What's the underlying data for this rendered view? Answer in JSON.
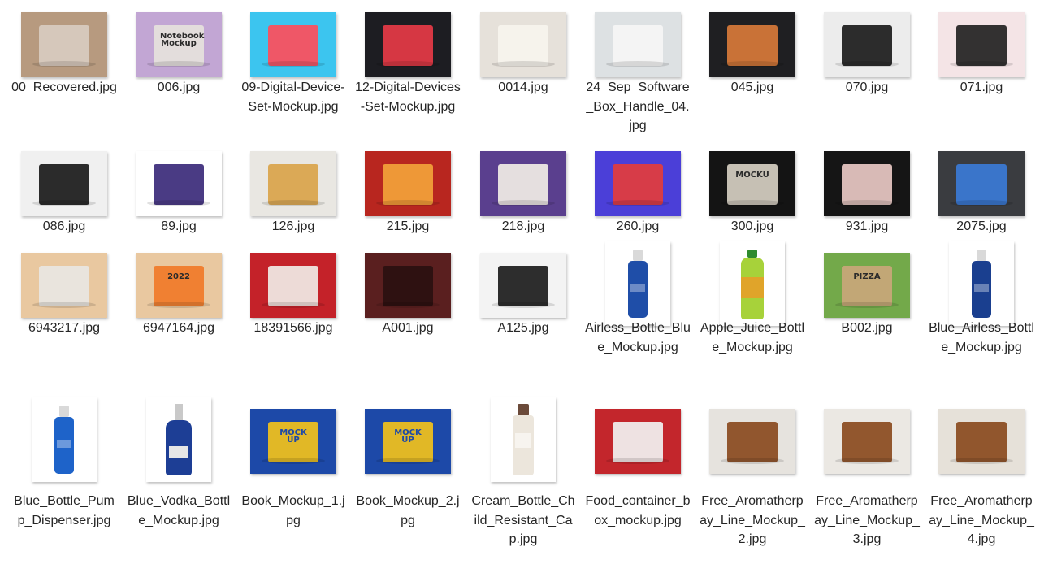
{
  "files": [
    {
      "name": "00_Recovered.jpg",
      "icon": "image-thumbnail",
      "bg": "#b79a7f",
      "accent": "#d8ccc0"
    },
    {
      "name": "006.jpg",
      "icon": "image-thumbnail",
      "bg": "#c2a6d4",
      "accent": "#e6e2dc",
      "text": "Notebook Mockup"
    },
    {
      "name": "09-Digital-Device-Set-Mockup.jpg",
      "icon": "image-thumbnail",
      "bg": "#3cc5ef",
      "accent": "#ff4d5b"
    },
    {
      "name": "12-Digital-Devices-Set-Mockup.jpg",
      "icon": "image-thumbnail",
      "bg": "#1d1d22",
      "accent": "#e63946"
    },
    {
      "name": "0014.jpg",
      "icon": "image-thumbnail",
      "bg": "#e6e1da",
      "accent": "#f7f4ee"
    },
    {
      "name": "24_Sep_Software_Box_Handle_04.jpg",
      "icon": "image-thumbnail",
      "bg": "#dde1e3",
      "accent": "#f5f5f5"
    },
    {
      "name": "045.jpg",
      "icon": "image-thumbnail",
      "bg": "#1f1f22",
      "accent": "#d87a3a"
    },
    {
      "name": "070.jpg",
      "icon": "image-thumbnail",
      "bg": "#ececec",
      "accent": "#1b1b1b"
    },
    {
      "name": "071.jpg",
      "icon": "image-thumbnail",
      "bg": "#f4e4e6",
      "accent": "#222222"
    },
    {
      "name": "086.jpg",
      "icon": "image-thumbnail",
      "bg": "#f0f0f0",
      "accent": "#1a1a1a"
    },
    {
      "name": "89.jpg",
      "icon": "image-thumbnail",
      "bg": "#ffffff",
      "accent": "#3b2a7a"
    },
    {
      "name": "126.jpg",
      "icon": "image-thumbnail",
      "bg": "#e9e7e2",
      "accent": "#d9a44a"
    },
    {
      "name": "215.jpg",
      "icon": "image-thumbnail",
      "bg": "#b8261f",
      "accent": "#f2a23a"
    },
    {
      "name": "218.jpg",
      "icon": "image-thumbnail",
      "bg": "#5a3f8e",
      "accent": "#f1ede6"
    },
    {
      "name": "260.jpg",
      "icon": "image-thumbnail",
      "bg": "#4b3fd8",
      "accent": "#e33c3c"
    },
    {
      "name": "300.jpg",
      "icon": "image-thumbnail",
      "bg": "#141414",
      "accent": "#d6cfc2",
      "text": "MOCKU"
    },
    {
      "name": "931.jpg",
      "icon": "image-thumbnail",
      "bg": "#151515",
      "accent": "#e9c9c4"
    },
    {
      "name": "2075.jpg",
      "icon": "image-thumbnail",
      "bg": "#3a3c40",
      "accent": "#3b7bd6"
    },
    {
      "name": "6943217.jpg",
      "icon": "image-thumbnail",
      "bg": "#e9c8a0",
      "accent": "#e8e6e2"
    },
    {
      "name": "6947164.jpg",
      "icon": "image-thumbnail",
      "bg": "#e9c8a0",
      "accent": "#f07a28",
      "text": "2022"
    },
    {
      "name": "18391566.jpg",
      "icon": "image-thumbnail",
      "bg": "#c42229",
      "accent": "#f0ece6"
    },
    {
      "name": "A001.jpg",
      "icon": "image-thumbnail",
      "bg": "#5a1f1f",
      "accent": "#2a1010"
    },
    {
      "name": "A125.jpg",
      "icon": "image-thumbnail",
      "bg": "#f3f3f3",
      "accent": "#1c1c1c"
    },
    {
      "name": "Airless_Bottle_Blue_Mockup.jpg",
      "icon": "image-thumbnail",
      "bg": "#ffffff",
      "accent": "#1f4ea8",
      "portrait": true,
      "shape": "bottle"
    },
    {
      "name": "Apple_Juice_Bottle_Mockup.jpg",
      "icon": "image-thumbnail",
      "bg": "#ffffff",
      "accent": "#a7d23a",
      "portrait": true,
      "shape": "juice"
    },
    {
      "name": "B002.jpg",
      "icon": "image-thumbnail",
      "bg": "#73a94a",
      "accent": "#c9a77a",
      "text": "PIZZA"
    },
    {
      "name": "Blue_Airless_Bottle_Mockup.jpg",
      "icon": "image-thumbnail",
      "bg": "#ffffff",
      "accent": "#1a3f8f",
      "portrait": true,
      "shape": "bottle"
    },
    {
      "name": "Blue_Bottle_Pump_Dispenser.jpg",
      "icon": "image-thumbnail",
      "bg": "#ffffff",
      "accent": "#1e63c9",
      "portrait": true,
      "shape": "pump"
    },
    {
      "name": "Blue_Vodka_Bottle_Mockup.jpg",
      "icon": "image-thumbnail",
      "bg": "#ffffff",
      "accent": "#1d3e95",
      "portrait": true,
      "shape": "vodka"
    },
    {
      "name": "Book_Mockup_1.jpg",
      "icon": "image-thumbnail",
      "bg": "#1d49a8",
      "accent": "#f2c21b",
      "text": "MOCK UP"
    },
    {
      "name": "Book_Mockup_2.jpg",
      "icon": "image-thumbnail",
      "bg": "#1d49a8",
      "accent": "#f2c21b",
      "text": "MOCK UP"
    },
    {
      "name": "Cream_Bottle_Child_Resistant_Cap.jpg",
      "icon": "image-thumbnail",
      "bg": "#ffffff",
      "accent": "#ece6dc",
      "portrait": true,
      "shape": "cream"
    },
    {
      "name": "Food_container_box_mockup.jpg",
      "icon": "image-thumbnail",
      "bg": "#c3262c",
      "accent": "#f2f2f2"
    },
    {
      "name": "Free_Aromatherpay_Line_Mockup_2.jpg",
      "icon": "image-thumbnail",
      "bg": "#e6e3de",
      "accent": "#8a4a1e"
    },
    {
      "name": "Free_Aromatherpay_Line_Mockup_3.jpg",
      "icon": "image-thumbnail",
      "bg": "#ebe8e3",
      "accent": "#8a4a1e"
    },
    {
      "name": "Free_Aromatherpay_Line_Mockup_4.jpg",
      "icon": "image-thumbnail",
      "bg": "#e6e1d9",
      "accent": "#8a4a1e"
    }
  ]
}
